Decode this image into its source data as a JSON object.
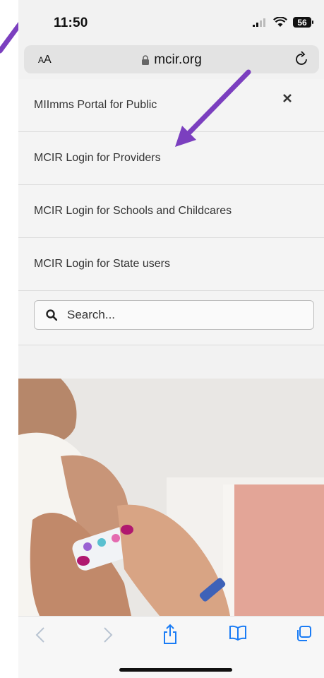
{
  "status": {
    "time": "11:50",
    "battery": "56"
  },
  "browser": {
    "text_size_label_small": "A",
    "text_size_label_large": "A",
    "domain": "mcir.org"
  },
  "menu": {
    "items": [
      {
        "label": "MIImms Portal for Public"
      },
      {
        "label": "MCIR Login for Providers"
      },
      {
        "label": "MCIR Login for Schools and Childcares"
      },
      {
        "label": "MCIR Login for State users"
      }
    ],
    "search_placeholder": "Search..."
  },
  "colors": {
    "annotation_arrow": "#7b3fbf",
    "toolbar_icon": "#1a7cf5",
    "toolbar_icon_disabled": "#b9c4d2"
  }
}
